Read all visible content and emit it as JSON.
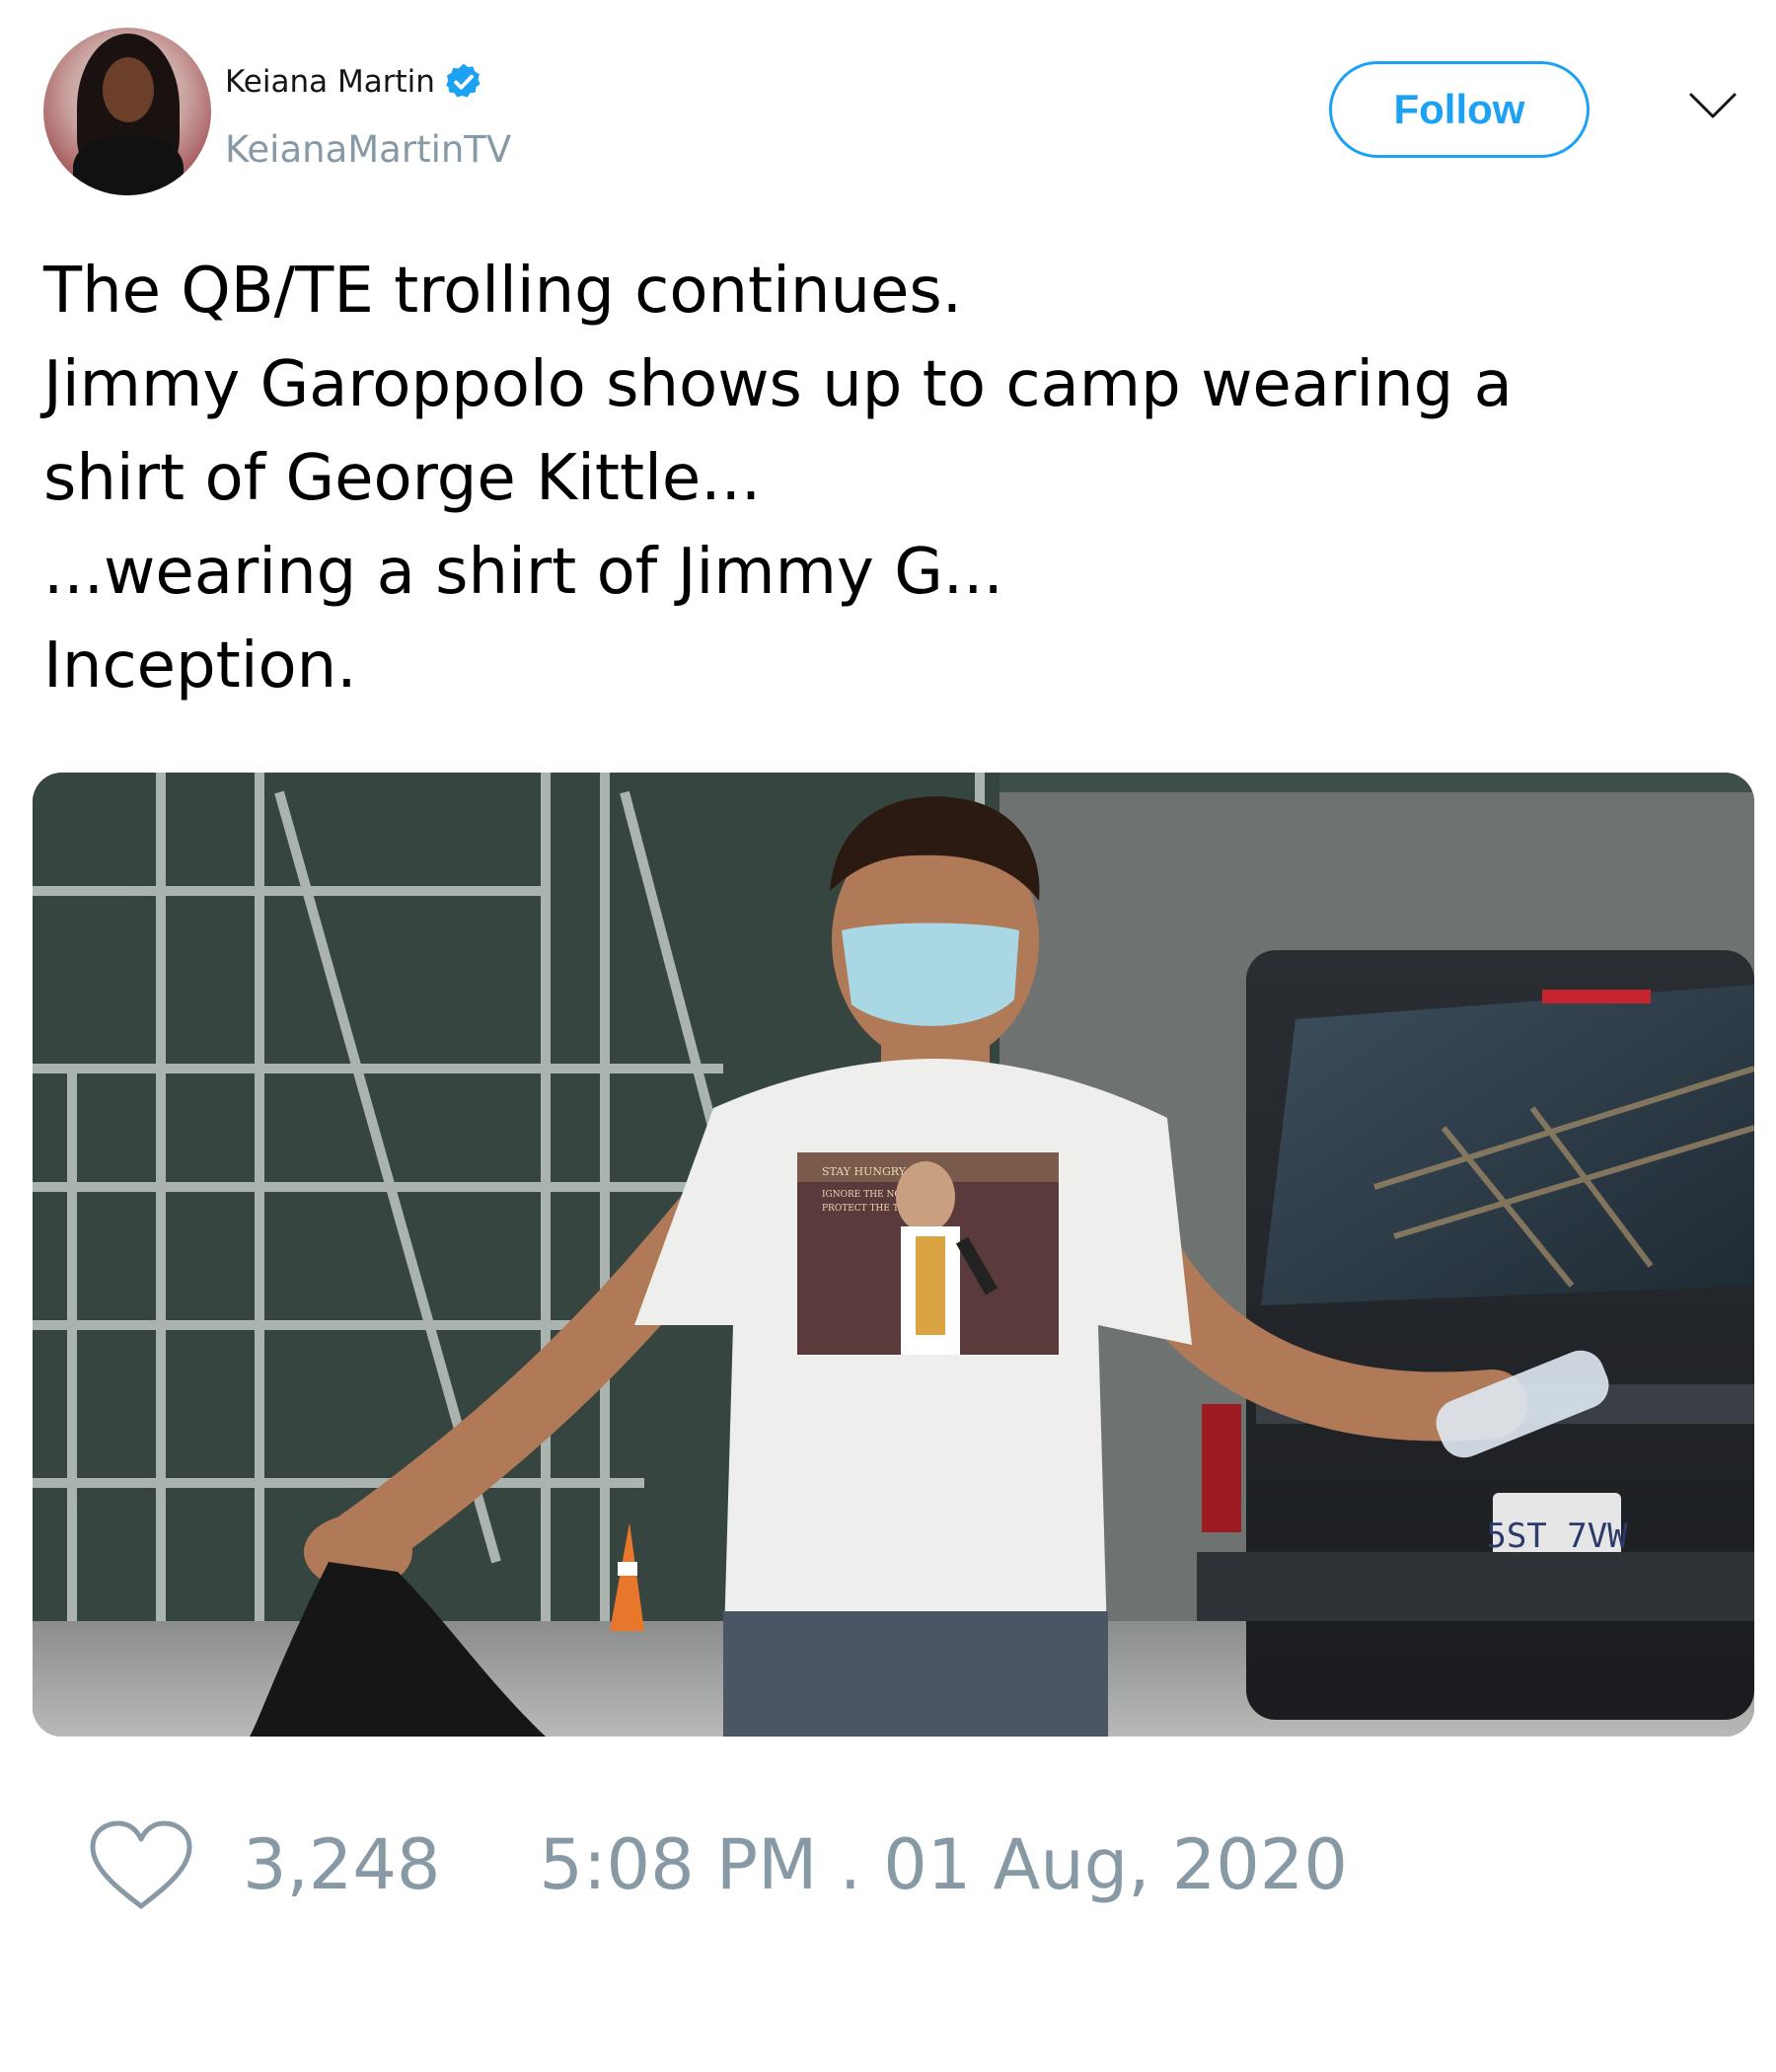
{
  "author": {
    "name": "Keiana Martin",
    "handle": "KeianaMartinTV",
    "verified": true
  },
  "follow_button": {
    "label": "Follow"
  },
  "menu": {
    "icon": "chevron-down-icon"
  },
  "tweet": {
    "lines": [
      "The QB/TE trolling continues.",
      "Jimmy Garoppolo shows up to camp wearing a",
      "shirt of George Kittle...",
      "...wearing a shirt of Jimmy G...",
      "Inception."
    ]
  },
  "media": {
    "plate": "5ST 7VW",
    "shirt_text_1": "STAY HUNGRY",
    "shirt_text_2": "IGNORE THE NOISE",
    "shirt_text_3": "PROTECT THE TEAM"
  },
  "stats": {
    "like_icon": "heart-icon",
    "likes": "3,248",
    "timestamp": "5:08 PM . 01 Aug, 2020"
  },
  "colors": {
    "accent": "#1da1f2",
    "muted": "#8899a6",
    "text": "#000000"
  }
}
